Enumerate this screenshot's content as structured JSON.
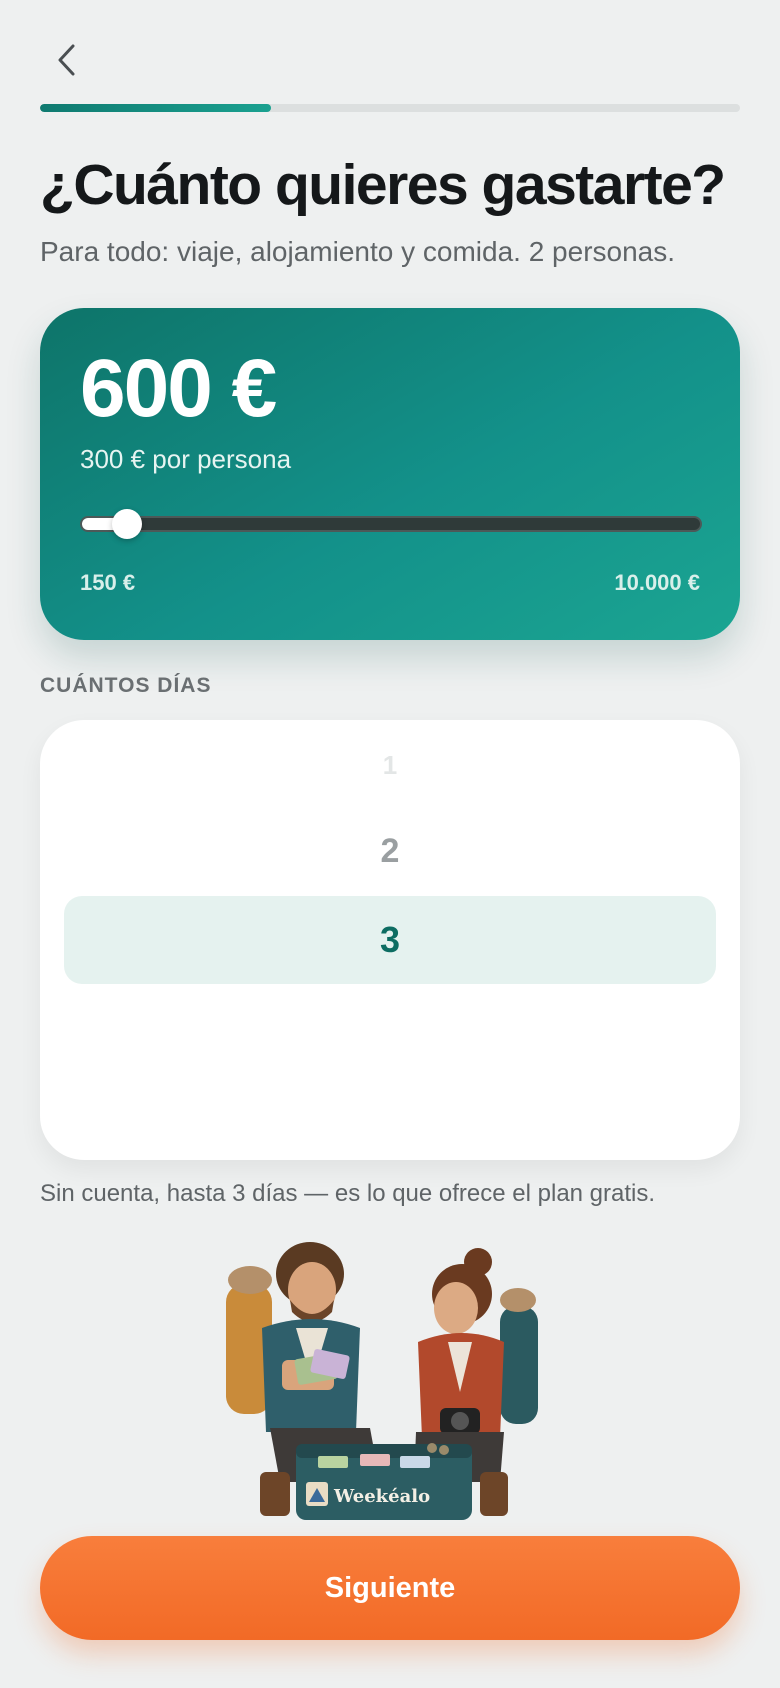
{
  "nav": {
    "back_icon": "chevron-left-icon"
  },
  "progress": {
    "value": 0.33
  },
  "header": {
    "title": "¿Cuánto quieres gastarte?",
    "subtitle": "Para todo: viaje, alojamiento y comida. 2 personas."
  },
  "budget": {
    "amount": "600 €",
    "per_person": "300 € por persona",
    "min_label": "150 €",
    "max_label": "10.000 €",
    "min_value": 150,
    "max_value": 10000,
    "value": 600
  },
  "days": {
    "label": "CUÁNTOS DÍAS",
    "options": [
      "1",
      "2",
      "3"
    ],
    "selected": "3"
  },
  "plan_note": "Sin cuenta, hasta 3 días — es lo que ofrece el plan gratis.",
  "illustration": {
    "suitcase_text": "Weekéalo"
  },
  "footer": {
    "next_label": "Siguiente"
  },
  "colors": {
    "accent_teal": "#13918a",
    "accent_orange": "#f26a26",
    "background": "#eef0f0"
  }
}
